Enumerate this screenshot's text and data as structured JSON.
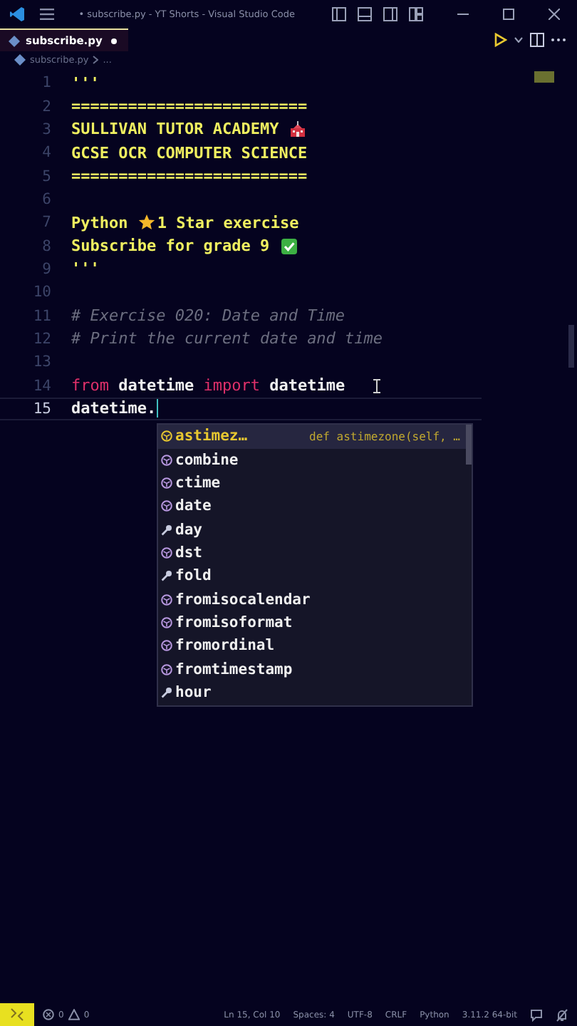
{
  "window": {
    "title": "• subscribe.py - YT Shorts - Visual Studio Code"
  },
  "tabs": [
    {
      "label": "subscribe.py",
      "selected": true,
      "modified": true
    }
  ],
  "breadcrumb": [
    "subscribe.py",
    "..."
  ],
  "editor": {
    "lines": [
      {
        "number": "1",
        "tokens": [
          {
            "kind": "string",
            "text": "'''"
          }
        ]
      },
      {
        "number": "2",
        "tokens": [
          {
            "kind": "string",
            "text": "========================="
          }
        ]
      },
      {
        "number": "3",
        "tokens": [
          {
            "kind": "string",
            "text": "SULLIVAN TUTOR ACADEMY "
          },
          {
            "kind": "icon"
          }
        ]
      },
      {
        "number": "4",
        "tokens": [
          {
            "kind": "string",
            "text": "GCSE OCR COMPUTER SCIENCE"
          }
        ]
      },
      {
        "number": "5",
        "tokens": [
          {
            "kind": "string",
            "text": "========================="
          }
        ]
      },
      {
        "number": "6"
      },
      {
        "number": "7",
        "tokens": [
          {
            "kind": "string",
            "text": "Python "
          },
          {
            "kind": "icon"
          },
          {
            "kind": "string",
            "text": "1 Star exercise"
          }
        ]
      },
      {
        "number": "8",
        "tokens": [
          {
            "kind": "string",
            "text": "Subscribe for grade 9 "
          },
          {
            "kind": "icon"
          }
        ]
      },
      {
        "number": "9",
        "tokens": [
          {
            "kind": "string",
            "text": "'''"
          }
        ]
      },
      {
        "number": "10"
      },
      {
        "number": "11",
        "tokens": [
          {
            "kind": "comment",
            "text": "# Exercise 020: Date and Time"
          }
        ]
      },
      {
        "number": "12",
        "tokens": [
          {
            "kind": "comment",
            "text": "# Print the current date and time"
          }
        ]
      },
      {
        "number": "13"
      },
      {
        "number": "14",
        "tokens": [
          {
            "kind": "keyword",
            "text": "from"
          },
          {
            "kind": "plain",
            "text": " datetime "
          },
          {
            "kind": "keyword",
            "text": "import"
          },
          {
            "kind": "plain",
            "text": " datetime"
          }
        ]
      },
      {
        "number": "15",
        "current": true,
        "tokens": [
          {
            "kind": "plain",
            "text": "datetime."
          }
        ]
      }
    ]
  },
  "suggestions": [
    {
      "label": "astimez…",
      "kind": "method",
      "selected": true,
      "detail": "def astimezone(self, …"
    },
    {
      "label": "combine",
      "kind": "method",
      "selected": false
    },
    {
      "label": "ctime",
      "kind": "method",
      "selected": false
    },
    {
      "label": "date",
      "kind": "method",
      "selected": false
    },
    {
      "label": "day",
      "kind": "property",
      "selected": false
    },
    {
      "label": "dst",
      "kind": "method",
      "selected": false
    },
    {
      "label": "fold",
      "kind": "property",
      "selected": false
    },
    {
      "label": "fromisocalendar",
      "kind": "method",
      "selected": false
    },
    {
      "label": "fromisoformat",
      "kind": "method",
      "selected": false
    },
    {
      "label": "fromordinal",
      "kind": "method",
      "selected": false
    },
    {
      "label": "fromtimestamp",
      "kind": "method",
      "selected": false
    },
    {
      "label": "hour",
      "kind": "property",
      "selected": false
    }
  ],
  "status_bar": {
    "errors": "0",
    "warnings": "0",
    "items": [
      "Ln 15, Col 10",
      "Spaces: 4",
      "UTF-8",
      "CRLF",
      "Python",
      "3.11.2 64-bit"
    ]
  }
}
